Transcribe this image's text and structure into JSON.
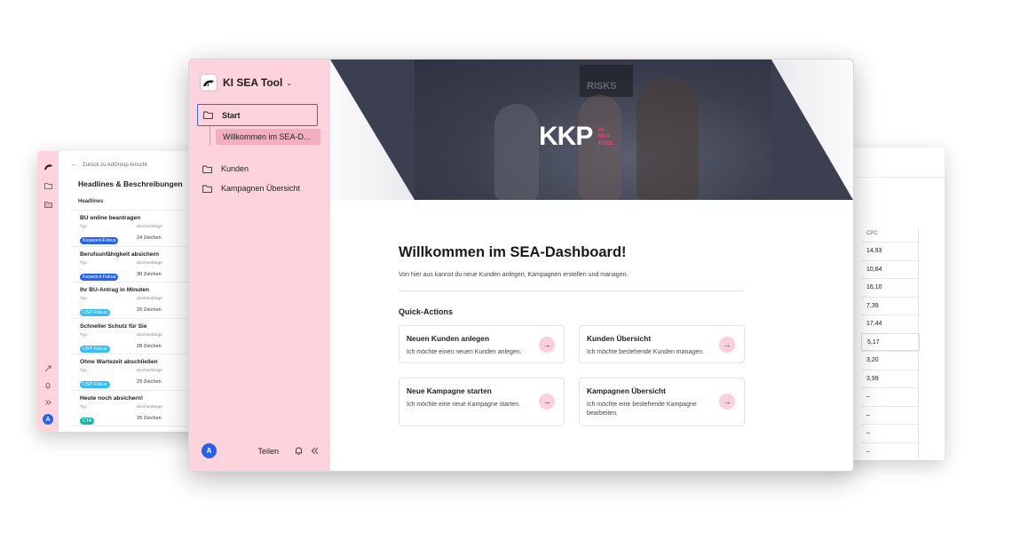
{
  "left_window": {
    "back_link": "Zurück zu AdGroup Ansicht",
    "title": "Headlines & Beschreibungen",
    "section": "Headlines",
    "col_type": "Typ",
    "col_length": "Zeichenlänge",
    "items": [
      {
        "headline": "BU online beantragen",
        "badge": "Keyword-Fokus",
        "badge_color": "#2563eb",
        "length": "24 Zeichen"
      },
      {
        "headline": "Berufsunfähigkeit absichern",
        "badge": "Keyword-Fokus",
        "badge_color": "#2563eb",
        "length": "30 Zeichen"
      },
      {
        "headline": "Ihr BU-Antrag in Minuten",
        "badge": "USP-Fokus",
        "badge_color": "#38bdf8",
        "length": "29 Zeichen"
      },
      {
        "headline": "Schneller Schutz für Sie",
        "badge": "USP-Fokus",
        "badge_color": "#38bdf8",
        "length": "28 Zeichen"
      },
      {
        "headline": "Ohne Wartezeit abschließen",
        "badge": "USP-Fokus",
        "badge_color": "#38bdf8",
        "length": "29 Zeichen"
      },
      {
        "headline": "Heute noch absichern!",
        "badge": "CTA",
        "badge_color": "#14b8a6",
        "length": "25 Zeichen"
      }
    ],
    "avatar": "A"
  },
  "right_window": {
    "col_header": "CPC",
    "rows": [
      "14,93",
      "10,84",
      "16,10",
      "7,39",
      "17,44",
      "5,17",
      "3,20",
      "3,99",
      "–",
      "–",
      "–",
      "–"
    ]
  },
  "main_window": {
    "brand_name": "KI SEA Tool",
    "nav": {
      "start": "Start",
      "start_sub": "Willkommen im SEA-D...",
      "customers": "Kunden",
      "campaigns": "Kampagnen Übersicht"
    },
    "bottom": {
      "avatar": "A",
      "share": "Teilen"
    },
    "hero": {
      "sign": "RISKS",
      "logo_main": "KKP",
      "logo_sub_1": "AI",
      "logo_sub_2": "SEA",
      "logo_sub_3": "TOOL"
    },
    "welcome_title": "Willkommen im SEA-Dashboard!",
    "welcome_desc": "Von hier aus kannst du neue Kunden anlegen, Kampagnen erstellen und managen.",
    "quick_actions_title": "Quick-Actions",
    "quick_actions": [
      {
        "title": "Neuen Kunden anlegen",
        "desc": "Ich möchte einen neuen Kunden anlegen."
      },
      {
        "title": "Kunden Übersicht",
        "desc": "Ich möchte bestehende Kunden managen."
      },
      {
        "title": "Neue Kampagne starten",
        "desc": "Ich möchte eine neue Kampagne starten."
      },
      {
        "title": "Kampagnen Übersicht",
        "desc": "Ich möchte eine bestehende Kampagne bearbeiten."
      }
    ],
    "accent_color": "#fdd3de",
    "focus_color": "#3a67d6"
  }
}
